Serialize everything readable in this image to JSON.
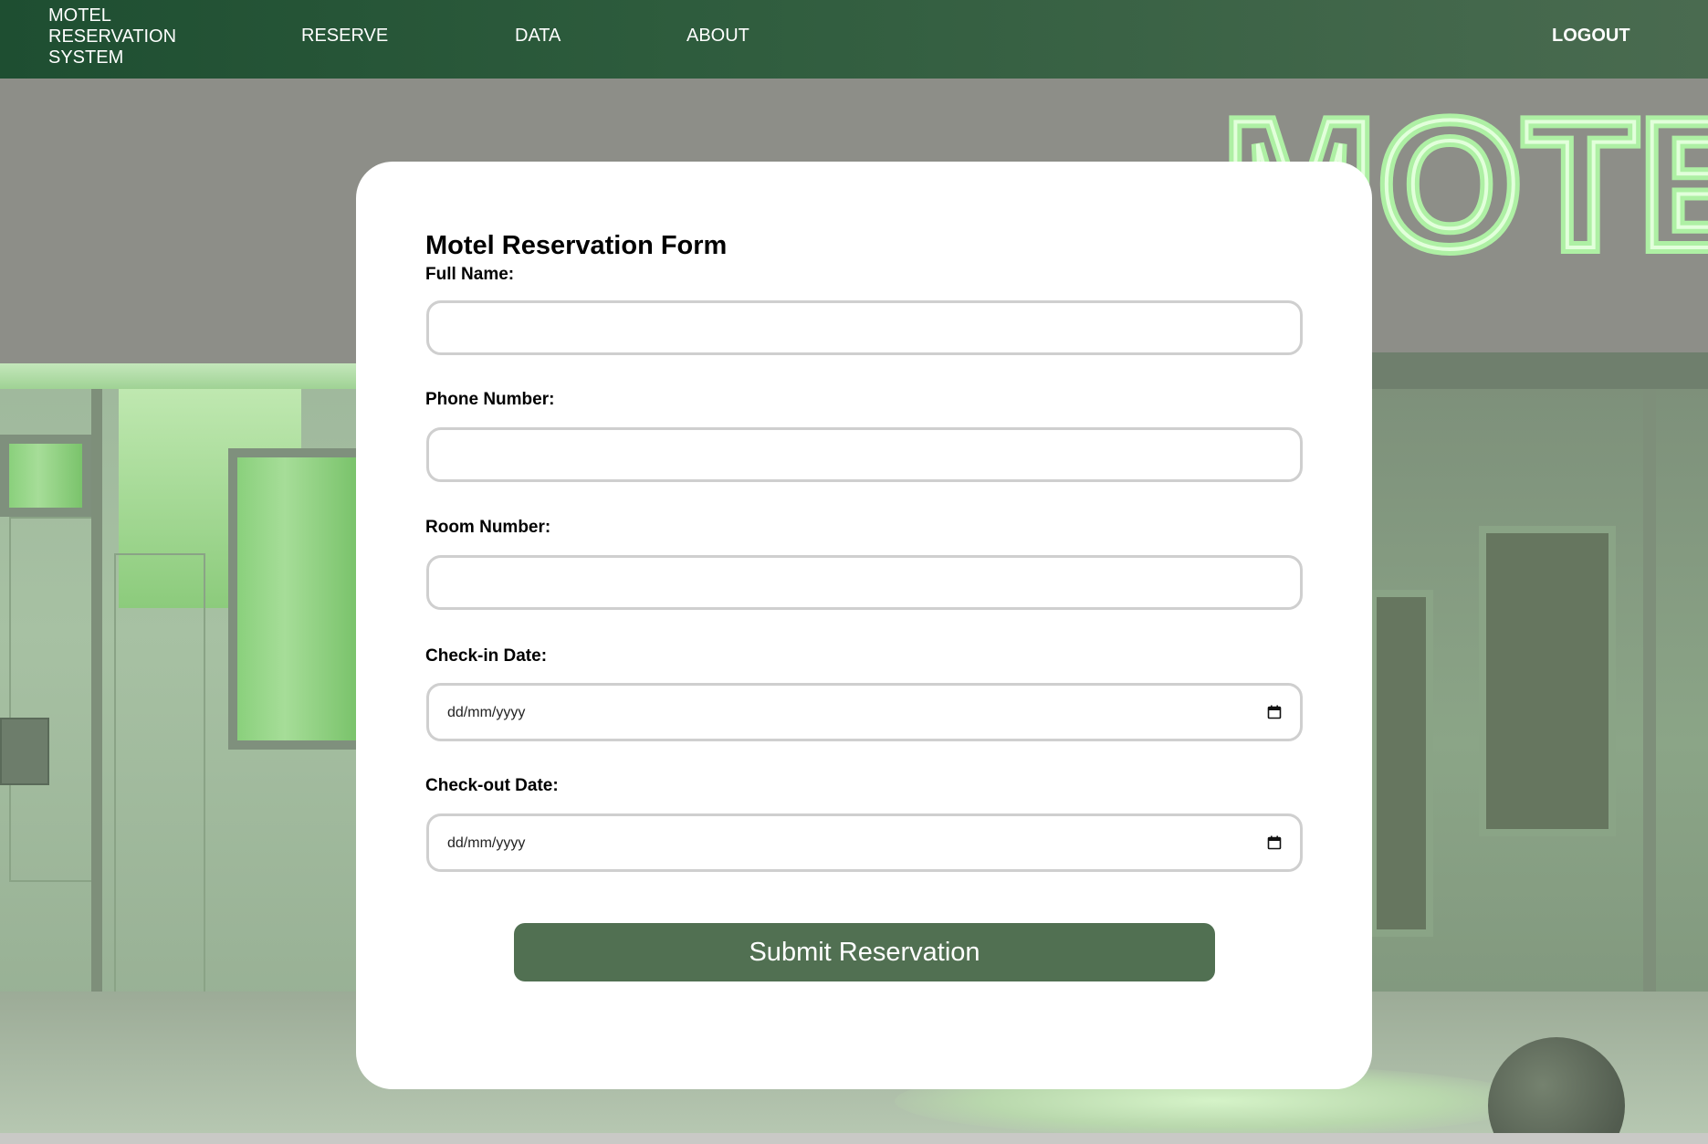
{
  "nav": {
    "brand": "MOTEL\nRESERVATION\nSYSTEM",
    "links": [
      {
        "label": "RESERVE"
      },
      {
        "label": "DATA"
      },
      {
        "label": "ABOUT"
      }
    ],
    "logout": "LOGOUT"
  },
  "background": {
    "sign_text": "MOTE",
    "icon": "motel-exterior-photo"
  },
  "form": {
    "title": "Motel Reservation Form",
    "fields": [
      {
        "label": "Full Name:",
        "value": "",
        "type": "text"
      },
      {
        "label": "Phone Number:",
        "value": "",
        "type": "text"
      },
      {
        "label": "Room Number:",
        "value": "",
        "type": "text"
      },
      {
        "label": "Check-in Date:",
        "placeholder": "dd/mm/yyyy",
        "type": "date"
      },
      {
        "label": "Check-out Date:",
        "placeholder": "dd/mm/yyyy",
        "type": "date"
      }
    ],
    "submit_label": "Submit Reservation"
  },
  "colors": {
    "nav_start": "#1e4e31",
    "nav_end": "#4a6b50",
    "button": "#517052",
    "neon": "#9fe69a"
  }
}
